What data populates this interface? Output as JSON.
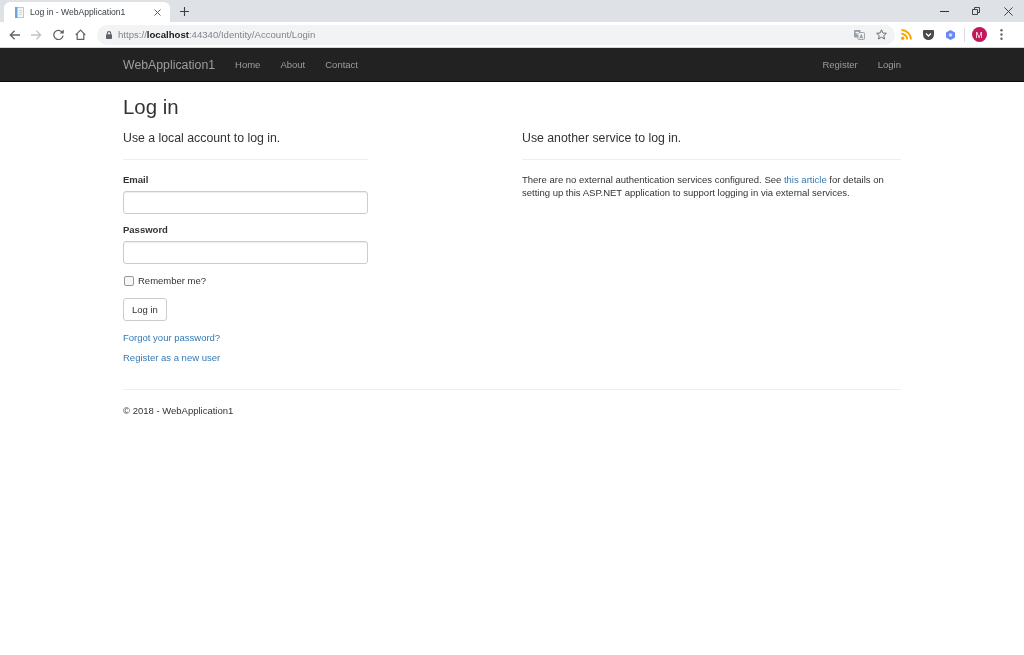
{
  "browser": {
    "tabs": [
      {
        "title": "Log in - WebApplication1",
        "selected": true
      }
    ],
    "nav_buttons": [
      {
        "kind": "back",
        "disabled": false
      },
      {
        "kind": "forward",
        "disabled": true
      },
      {
        "kind": "reload",
        "disabled": false
      },
      {
        "kind": "home",
        "disabled": false
      }
    ],
    "address": "https://**localhost**:44340/Identity/Account/Login",
    "profile_initial": "M"
  },
  "navbar": {
    "brand": "WebApplication1",
    "links": [
      "Home",
      "About",
      "Contact"
    ],
    "right_links": [
      "Register",
      "Login"
    ]
  },
  "title": "Log in",
  "local_login": {
    "heading": "Use a local account to log in.",
    "fields": [
      {
        "label": "Email"
      },
      {
        "label": "Password"
      }
    ],
    "remember": {
      "label": "Remember me?",
      "checked": false
    },
    "submit": "Log in",
    "links": [
      "Forgot your password?",
      "Register as a new user"
    ]
  },
  "external_login": {
    "heading": "Use another service to log in.",
    "text_before": "There are no external authentication services configured. See ",
    "link": "this article",
    "text_after": " for details on setting up this ASP.NET application to support logging in via external services."
  },
  "footer": {
    "text": "© 2018 - WebApplication1"
  }
}
